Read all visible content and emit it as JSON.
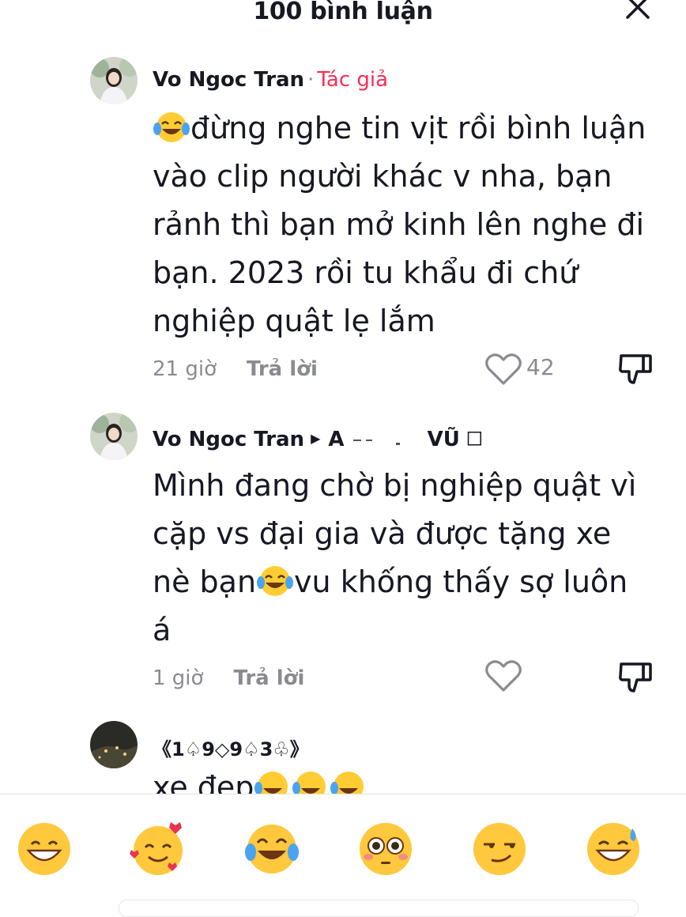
{
  "header": {
    "title": "100 bình luận"
  },
  "comments": [
    {
      "username": "Vo Ngoc Tran",
      "dot": "·",
      "author_badge": "Tác giả",
      "lines": [
        "đừng nghe tin vịt rồi bình luận",
        "vào clip người khác v nha, bạn",
        "rảnh thì bạn mở kinh lên nghe đi",
        "bạn. 2023 rồi tu khẩu đi chứ",
        "nghiệp quật lẹ lắm"
      ],
      "time": "21 giờ",
      "reply": "Trả lời",
      "likes": "42"
    },
    {
      "username": "Vo Ngoc Tran",
      "reply_to": "A",
      "reply_to_tail": "VŨ 🗆",
      "line1": "Mình đang chờ bị nghiệp quật vì",
      "line2": "cặp vs đại gia và được tặng xe",
      "line3_pre": "nè bạn",
      "line3_post": "vu khống thấy sợ luôn",
      "line4": "á",
      "time": "1 giờ",
      "reply": "Trả lời"
    },
    {
      "username": "《1♤9◇9♤3♧》",
      "text": "xe đẹp"
    }
  ],
  "emoji_bar": [
    "grinning-face",
    "smiling-face-with-hearts",
    "tears-of-joy",
    "flushed-face",
    "smirking-face",
    "grinning-sweat"
  ]
}
